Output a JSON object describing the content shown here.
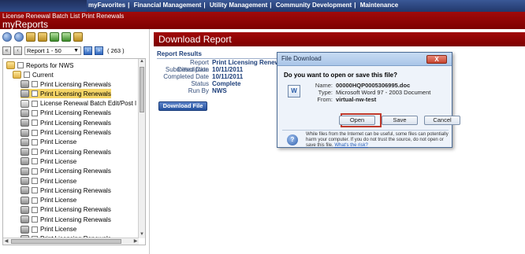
{
  "topnav": {
    "links": [
      "myFavorites",
      "Financial Management",
      "Utility Management",
      "Community Development",
      "Maintenance"
    ]
  },
  "header": {
    "subtitle": "License Renewal Batch List Print Renewals",
    "title": "myReports"
  },
  "pager": {
    "range": "Report 1 - 50",
    "count": "( 263 )"
  },
  "tree": {
    "root": "Reports for NWS",
    "current": "Current",
    "items": [
      {
        "label": "Print Licensing Renewals",
        "icon": "printer-icon",
        "selected": false
      },
      {
        "label": "Print Licensing Renewals",
        "icon": "printer-icon",
        "selected": true
      },
      {
        "label": "License Renewal Batch Edit/Post l",
        "icon": "document-icon",
        "selected": false
      },
      {
        "label": "Print Licensing Renewals",
        "icon": "printer-icon",
        "selected": false
      },
      {
        "label": "Print Licensing Renewals",
        "icon": "printer-icon",
        "selected": false
      },
      {
        "label": "Print Licensing Renewals",
        "icon": "printer-icon",
        "selected": false
      },
      {
        "label": "Print License",
        "icon": "printer-icon",
        "selected": false
      },
      {
        "label": "Print Licensing Renewals",
        "icon": "printer-icon",
        "selected": false
      },
      {
        "label": "Print License",
        "icon": "printer-icon",
        "selected": false
      },
      {
        "label": "Print Licensing Renewals",
        "icon": "printer-icon",
        "selected": false
      },
      {
        "label": "Print License",
        "icon": "printer-icon",
        "selected": false
      },
      {
        "label": "Print Licensing Renewals",
        "icon": "printer-icon",
        "selected": false
      },
      {
        "label": "Print License",
        "icon": "printer-icon",
        "selected": false
      },
      {
        "label": "Print Licensing Renewals",
        "icon": "printer-icon",
        "selected": false
      },
      {
        "label": "Print Licensing Renewals",
        "icon": "printer-icon",
        "selected": false
      },
      {
        "label": "Print License",
        "icon": "printer-icon",
        "selected": false
      },
      {
        "label": "Print Licensing Renewals",
        "icon": "printer-icon",
        "selected": false
      }
    ]
  },
  "main": {
    "heading": "Download Report",
    "results_heading": "Report Results",
    "fields": [
      {
        "label": "Report Description",
        "value": "Print Licensing Renewa"
      },
      {
        "label": "Submitted Date",
        "value": "10/11/2011"
      },
      {
        "label": "Completed Date",
        "value": "10/11/2011"
      },
      {
        "label": "Status",
        "value": "Complete"
      },
      {
        "label": "Run By",
        "value": "NWS"
      }
    ],
    "download_label": "Download File"
  },
  "dialog": {
    "title": "File Download",
    "close_label": "X",
    "question": "Do you want to open or save this file?",
    "name_label": "Name:",
    "name_value": "00000HQP0005306995.doc",
    "type_label": "Type:",
    "type_value": "Microsoft Word 97 - 2003 Document",
    "from_label": "From:",
    "from_value": "virtual-nw-test",
    "open_label": "Open",
    "save_label": "Save",
    "cancel_label": "Cancel",
    "warning_text": "While files from the Internet can be useful, some files can potentially harm your computer. If you do not trust the source, do not open or save this file.",
    "risk_link": "What's the risk?"
  }
}
